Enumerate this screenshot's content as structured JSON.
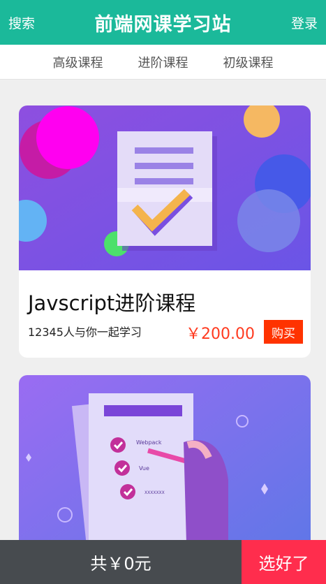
{
  "header": {
    "search_label": "搜索",
    "title": "前端网课学习站",
    "login_label": "登录"
  },
  "tabs": [
    {
      "label": "高级课程"
    },
    {
      "label": "进阶课程"
    },
    {
      "label": "初级课程"
    }
  ],
  "courses": [
    {
      "title": "Javscript进阶课程",
      "learners": "12345人与你一起学习",
      "price": "￥200.00",
      "buy_label": "购买",
      "banner_icon": "document-checklist-illustration"
    },
    {
      "banner_icon": "checklist-form-pen-illustration",
      "banner_text": [
        "Webpack",
        "Vue",
        "XXXXXXX"
      ]
    }
  ],
  "footer": {
    "total_label": "共￥0元",
    "choose_label": "选好了"
  },
  "colors": {
    "header_bg": "#1bb99a",
    "price": "#ff3a1f",
    "buy_bg": "#ff3300",
    "footer_total_bg": "#474b4f",
    "footer_choose_bg": "#ff2d4d"
  }
}
